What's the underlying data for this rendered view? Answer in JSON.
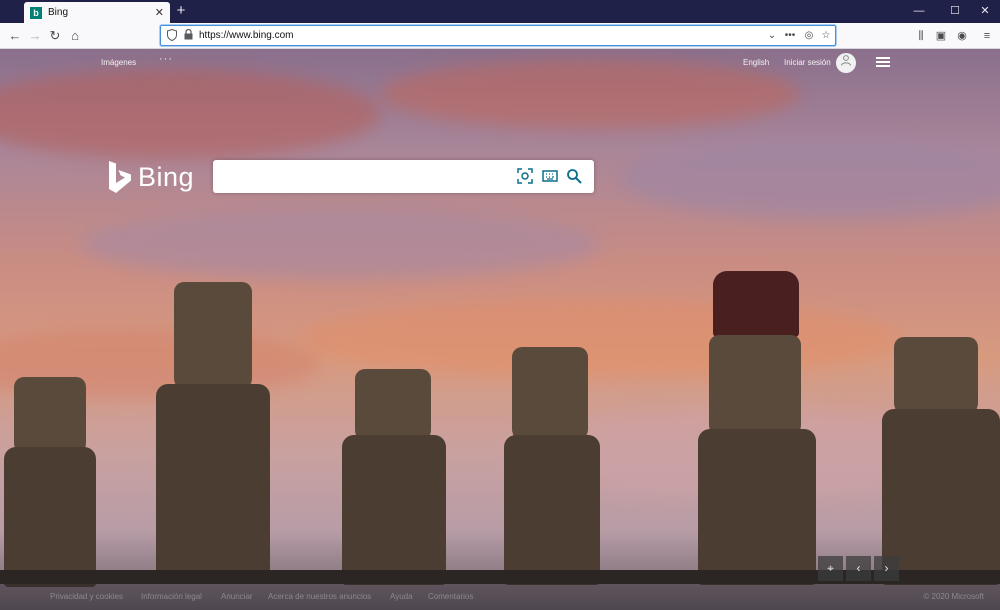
{
  "browser": {
    "tab": {
      "favicon": "b",
      "title": "Bing",
      "close": "✕"
    },
    "new_tab": "+",
    "window_controls": {
      "minimize": "—",
      "maximize": "☐",
      "close": "✕"
    },
    "nav": {
      "back": "←",
      "forward": "→",
      "reload": "↻",
      "home": "⌂"
    },
    "url": "https://www.bing.com",
    "url_actions": {
      "dropdown": "⌄",
      "more": "•••",
      "pocket": "◎",
      "bookmark": "☆"
    },
    "tools": {
      "library": "⫼",
      "sidebar": "▣",
      "account": "◉",
      "menu": "≡"
    }
  },
  "bing": {
    "header": {
      "images_link": "Imágenes",
      "more": "···",
      "language": "English",
      "sign_in": "Iniciar sesión",
      "avatar_glyph": "👤"
    },
    "logo_text": "Bing",
    "search": {
      "value": "",
      "placeholder": "",
      "visual_search": "⊡",
      "keyboard": "⌨",
      "search": "⌕"
    },
    "carousel": {
      "location": "⌖",
      "prev": "‹",
      "next": "›"
    },
    "footer": {
      "links": [
        "Privacidad y cookies",
        "Información legal",
        "Anunciar",
        "Acerca de nuestros anuncios",
        "Ayuda",
        "Comentarios"
      ],
      "copyright": "© 2020 Microsoft"
    }
  },
  "colors": {
    "bing_teal": "#008373",
    "titlebar": "#1f2149",
    "url_focus": "#4a90d9"
  }
}
